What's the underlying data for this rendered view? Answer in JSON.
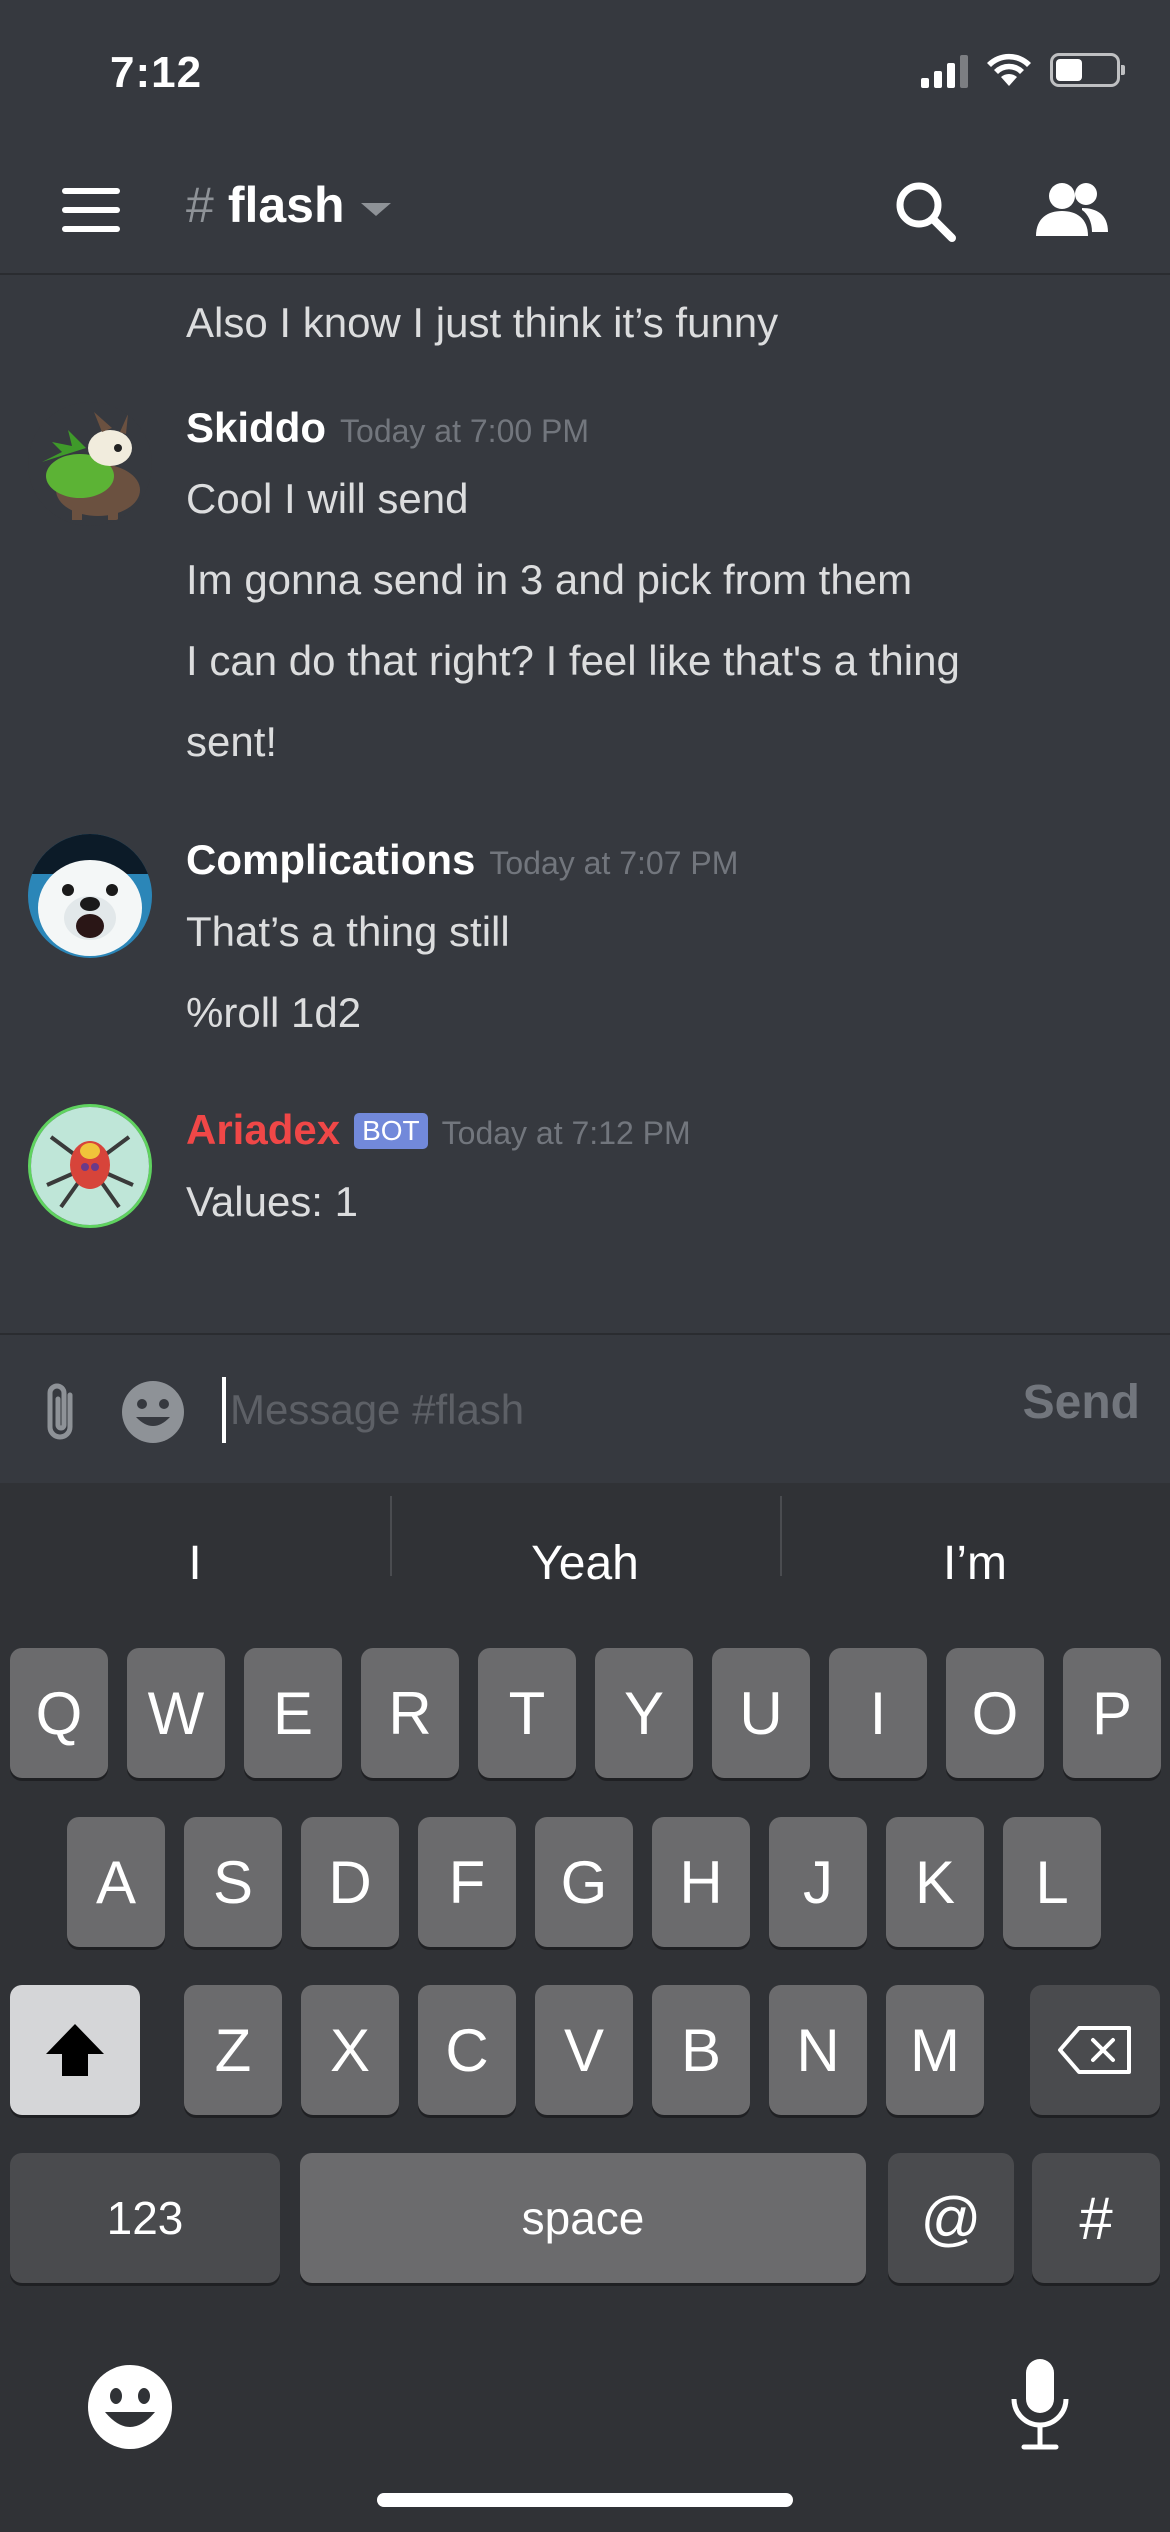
{
  "status_bar": {
    "time": "7:12"
  },
  "header": {
    "channel_hash": "#",
    "channel_name": "flash"
  },
  "messages": {
    "continuation": "Also I know I just think it’s funny",
    "groups": [
      {
        "author": "Skiddo",
        "timestamp": "Today at 7:00 PM",
        "lines": [
          "Cool I will send",
          "Im gonna send in 3 and pick from them",
          "I can do that right? I feel like that's a thing",
          "sent!"
        ]
      },
      {
        "author": "Complications",
        "timestamp": "Today at 7:07 PM",
        "lines": [
          "That’s a thing still",
          "%roll 1d2"
        ]
      },
      {
        "author": "Ariadex",
        "bot_tag": "BOT",
        "timestamp": "Today at 7:12 PM",
        "lines": [
          "Values: 1"
        ]
      }
    ]
  },
  "composer": {
    "placeholder": "Message #flash",
    "send_label": "Send"
  },
  "keyboard": {
    "predictions": [
      "I",
      "Yeah",
      "I’m"
    ],
    "row1": [
      "Q",
      "W",
      "E",
      "R",
      "T",
      "Y",
      "U",
      "I",
      "O",
      "P"
    ],
    "row2": [
      "A",
      "S",
      "D",
      "F",
      "G",
      "H",
      "J",
      "K",
      "L"
    ],
    "row3": [
      "Z",
      "X",
      "C",
      "V",
      "B",
      "N",
      "M"
    ],
    "numbers_label": "123",
    "space_label": "space",
    "at_label": "@",
    "hash_label": "#"
  },
  "colors": {
    "background": "#36393f",
    "bot_name": "#f04747",
    "bot_tag": "#7289da",
    "keyboard": "#303236"
  }
}
